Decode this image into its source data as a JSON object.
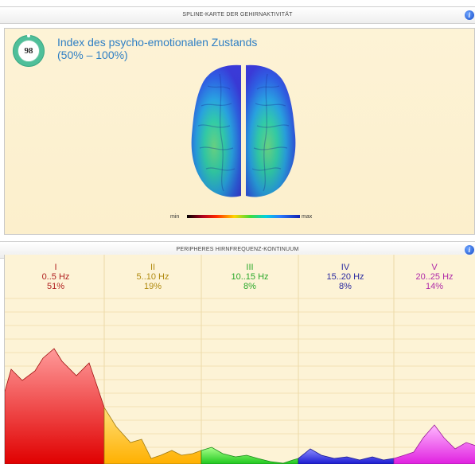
{
  "map_section": {
    "header": "SPLINE-KARTE DER GEHIRNAKTIVITÄT",
    "gauge_value": "98",
    "index_title_line1": "Index des psycho-emotionalen Zustands",
    "index_title_line2": "(50% – 100%)",
    "scale_min": "min",
    "scale_max": "max"
  },
  "spectrum_section": {
    "header": "PERIPHERES HIRNFREQUENZ-KONTINUUM",
    "bands": [
      {
        "name": "I",
        "range": "0..5 Hz",
        "percent": "51%",
        "color": "#b02020"
      },
      {
        "name": "II",
        "range": "5..10 Hz",
        "percent": "19%",
        "color": "#b08a10"
      },
      {
        "name": "III",
        "range": "10..15 Hz",
        "percent": "8%",
        "color": "#2aa82a"
      },
      {
        "name": "IV",
        "range": "15..20 Hz",
        "percent": "8%",
        "color": "#2a2aa0"
      },
      {
        "name": "V",
        "range": "20..25 Hz",
        "percent": "14%",
        "color": "#b02aa8"
      }
    ]
  },
  "info_icon": "info-icon"
}
